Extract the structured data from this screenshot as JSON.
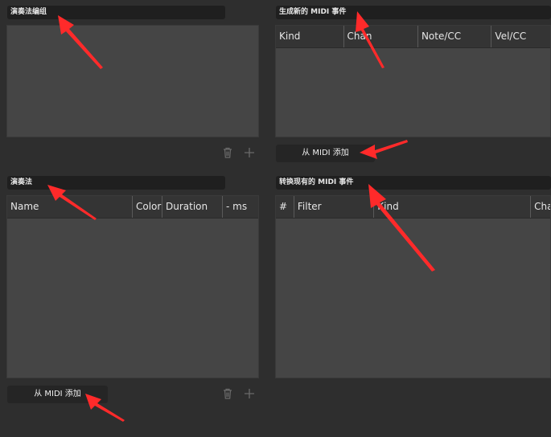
{
  "articulation_groups": {
    "title": "演奏法编组"
  },
  "generate_events": {
    "title": "生成新的 MIDI 事件",
    "columns": [
      "Kind",
      "Chan",
      "Note/CC",
      "Vel/CC"
    ],
    "add_button": "从 MIDI 添加"
  },
  "articulations": {
    "title": "演奏法",
    "columns": [
      "Name",
      "Color",
      "Duration",
      "- ms"
    ],
    "add_button": "从 MIDI 添加"
  },
  "convert_events": {
    "title": "转换现有的 MIDI 事件",
    "columns": [
      "#",
      "Filter",
      "Kind",
      "Chan"
    ]
  },
  "icons": {
    "delete": "trash-icon",
    "add": "plus-icon"
  },
  "colors": {
    "background": "#2e2e2e",
    "panel": "#454545",
    "header": "#1f1f1f",
    "annotation_arrow": "#ff2a2a"
  }
}
